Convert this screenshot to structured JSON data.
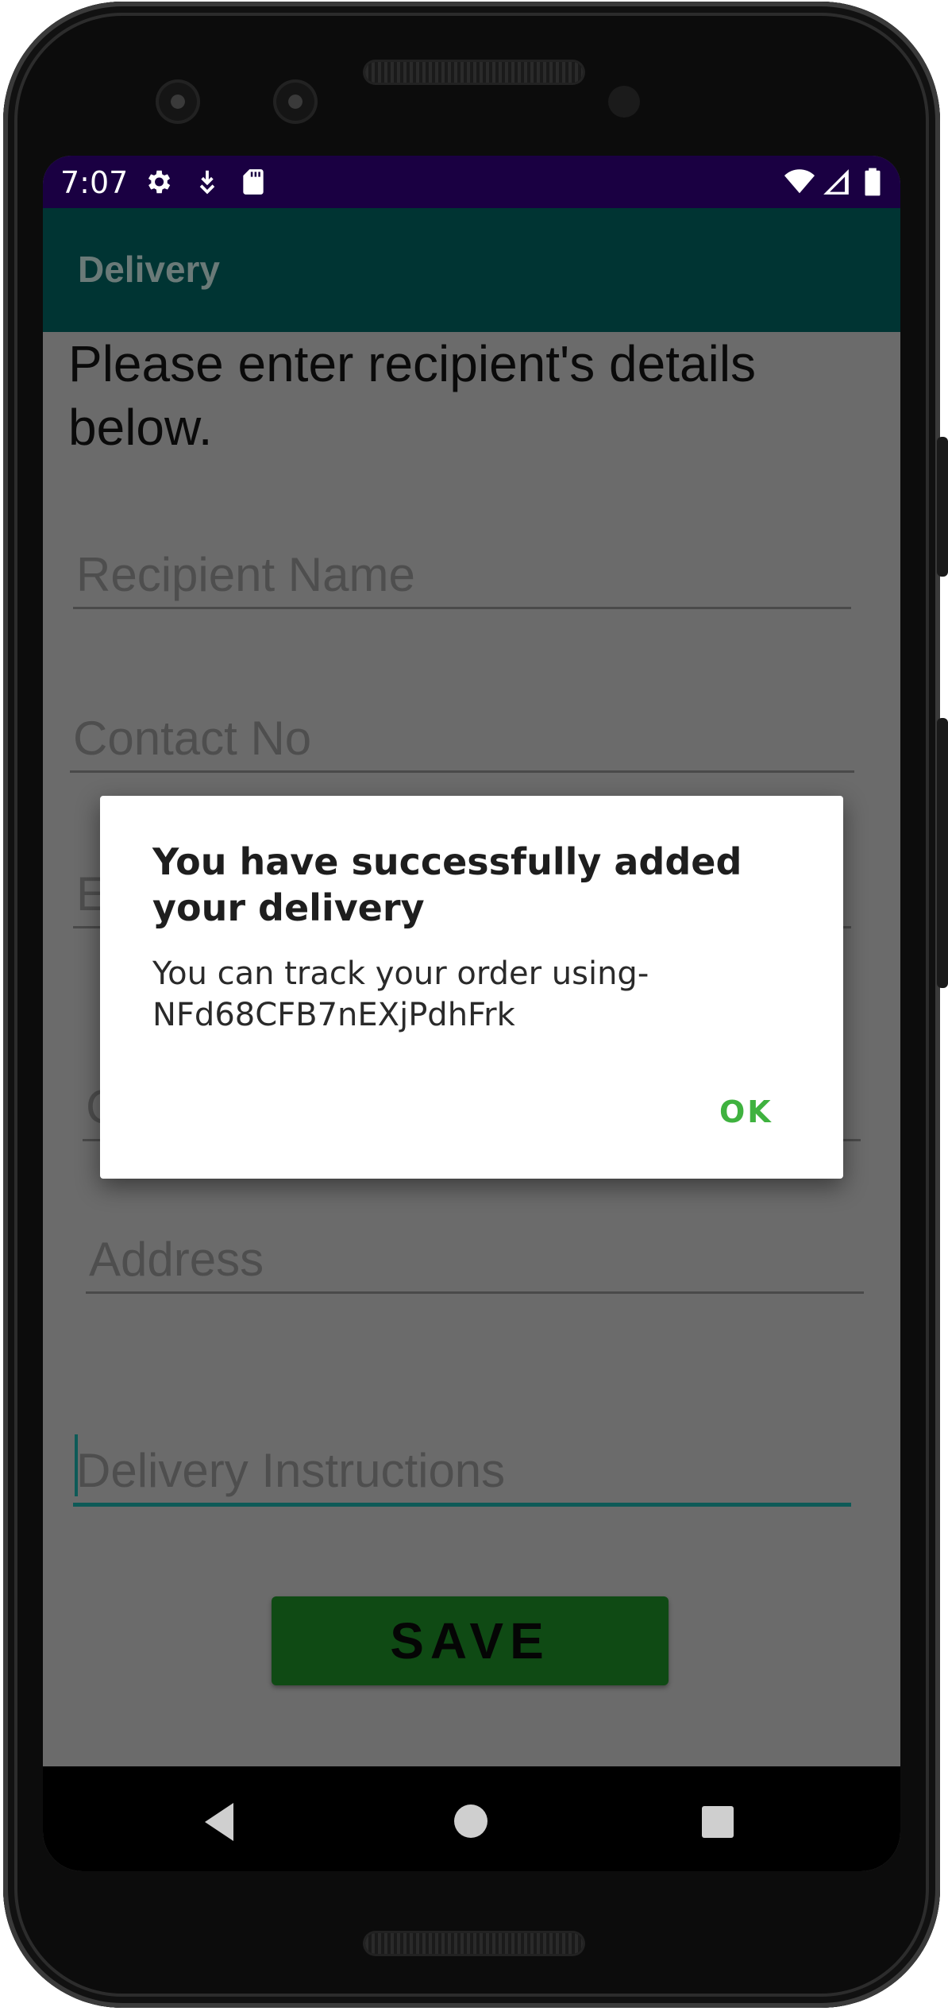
{
  "status_bar": {
    "time": "7:07",
    "icons": [
      "gear-icon",
      "download-icon",
      "sd-card-icon",
      "wifi-icon",
      "signal-icon",
      "battery-icon"
    ]
  },
  "app_bar": {
    "title": "Delivery",
    "color": "#003433"
  },
  "form": {
    "intro": "Please enter recipient's details below.",
    "fields": {
      "recipient_name": "Recipient Name",
      "contact_no": "Contact No",
      "email_fragment": "E",
      "obscured_fragment": "C",
      "address": "Address",
      "delivery_instructions": "Delivery Instructions"
    },
    "save_label": "SAVE",
    "save_color": "#0f4a14"
  },
  "dialog": {
    "title": "You have successfully added your delivery",
    "message": "You can track your order using-NFd68CFB7nEXjPdhFrk",
    "ok_label": "OK",
    "ok_color": "#3fb23f"
  },
  "nav_bar": {
    "icons": [
      "back-icon",
      "home-icon",
      "recents-icon"
    ]
  }
}
